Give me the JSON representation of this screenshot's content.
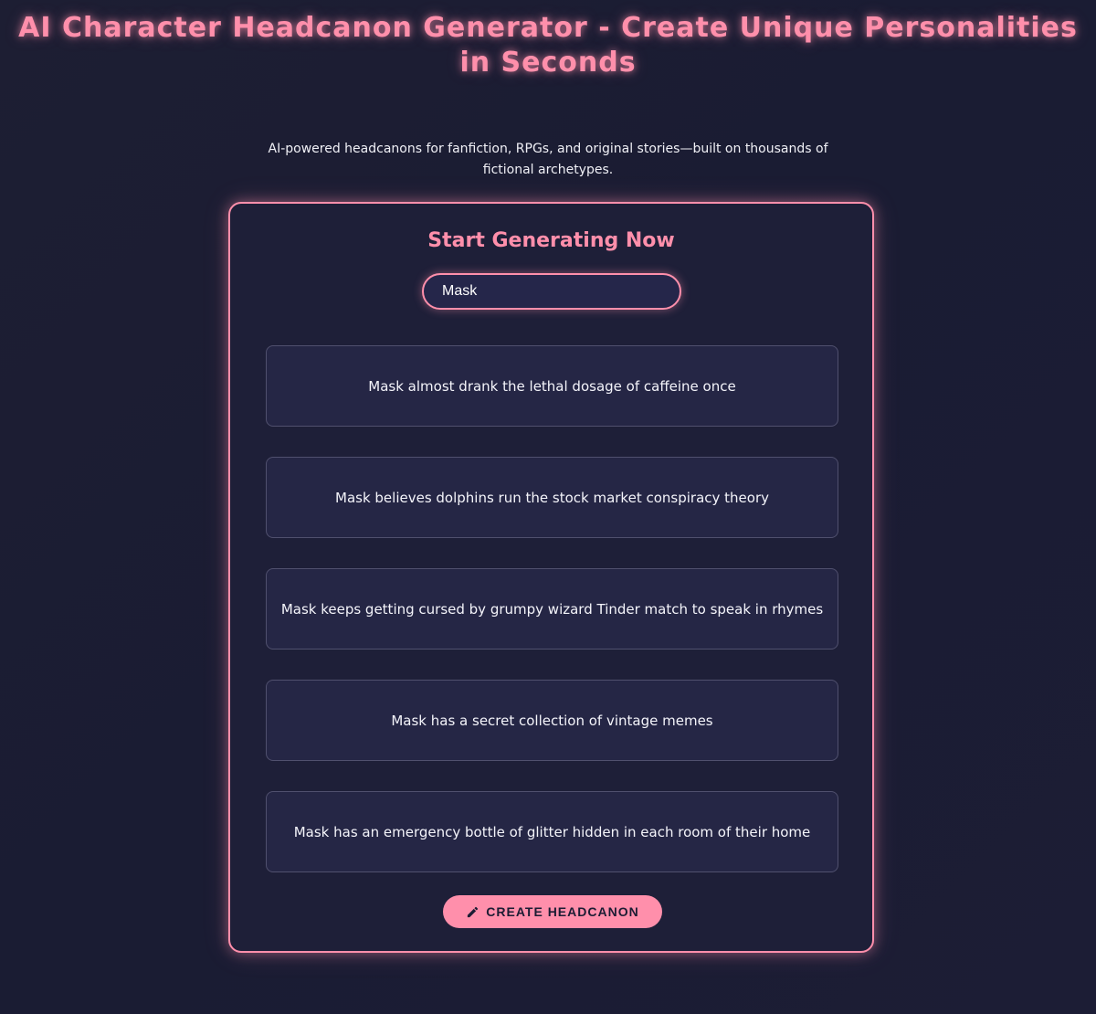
{
  "header": {
    "title": "AI Character Headcanon Generator - Create Unique Personalities in Seconds",
    "tagline": "AI-powered headcanons for fanfiction, RPGs, and original stories—built on thousands of fictional archetypes."
  },
  "generator": {
    "title": "Start Generating Now",
    "name_input": {
      "value": "Mask"
    },
    "results": [
      "Mask almost drank the lethal dosage of caffeine once",
      "Mask believes dolphins run the stock market conspiracy theory",
      "Mask keeps getting cursed by grumpy wizard Tinder match to speak in rhymes",
      "Mask has a secret collection of vintage memes",
      "Mask has an emergency bottle of glitter hidden in each room of their home"
    ],
    "button_label": "CREATE HEADCANON",
    "button_icon": "pencil-icon"
  },
  "colors": {
    "accent": "#ff8fab",
    "background": "#1c1d35",
    "card_background": "#252645"
  }
}
